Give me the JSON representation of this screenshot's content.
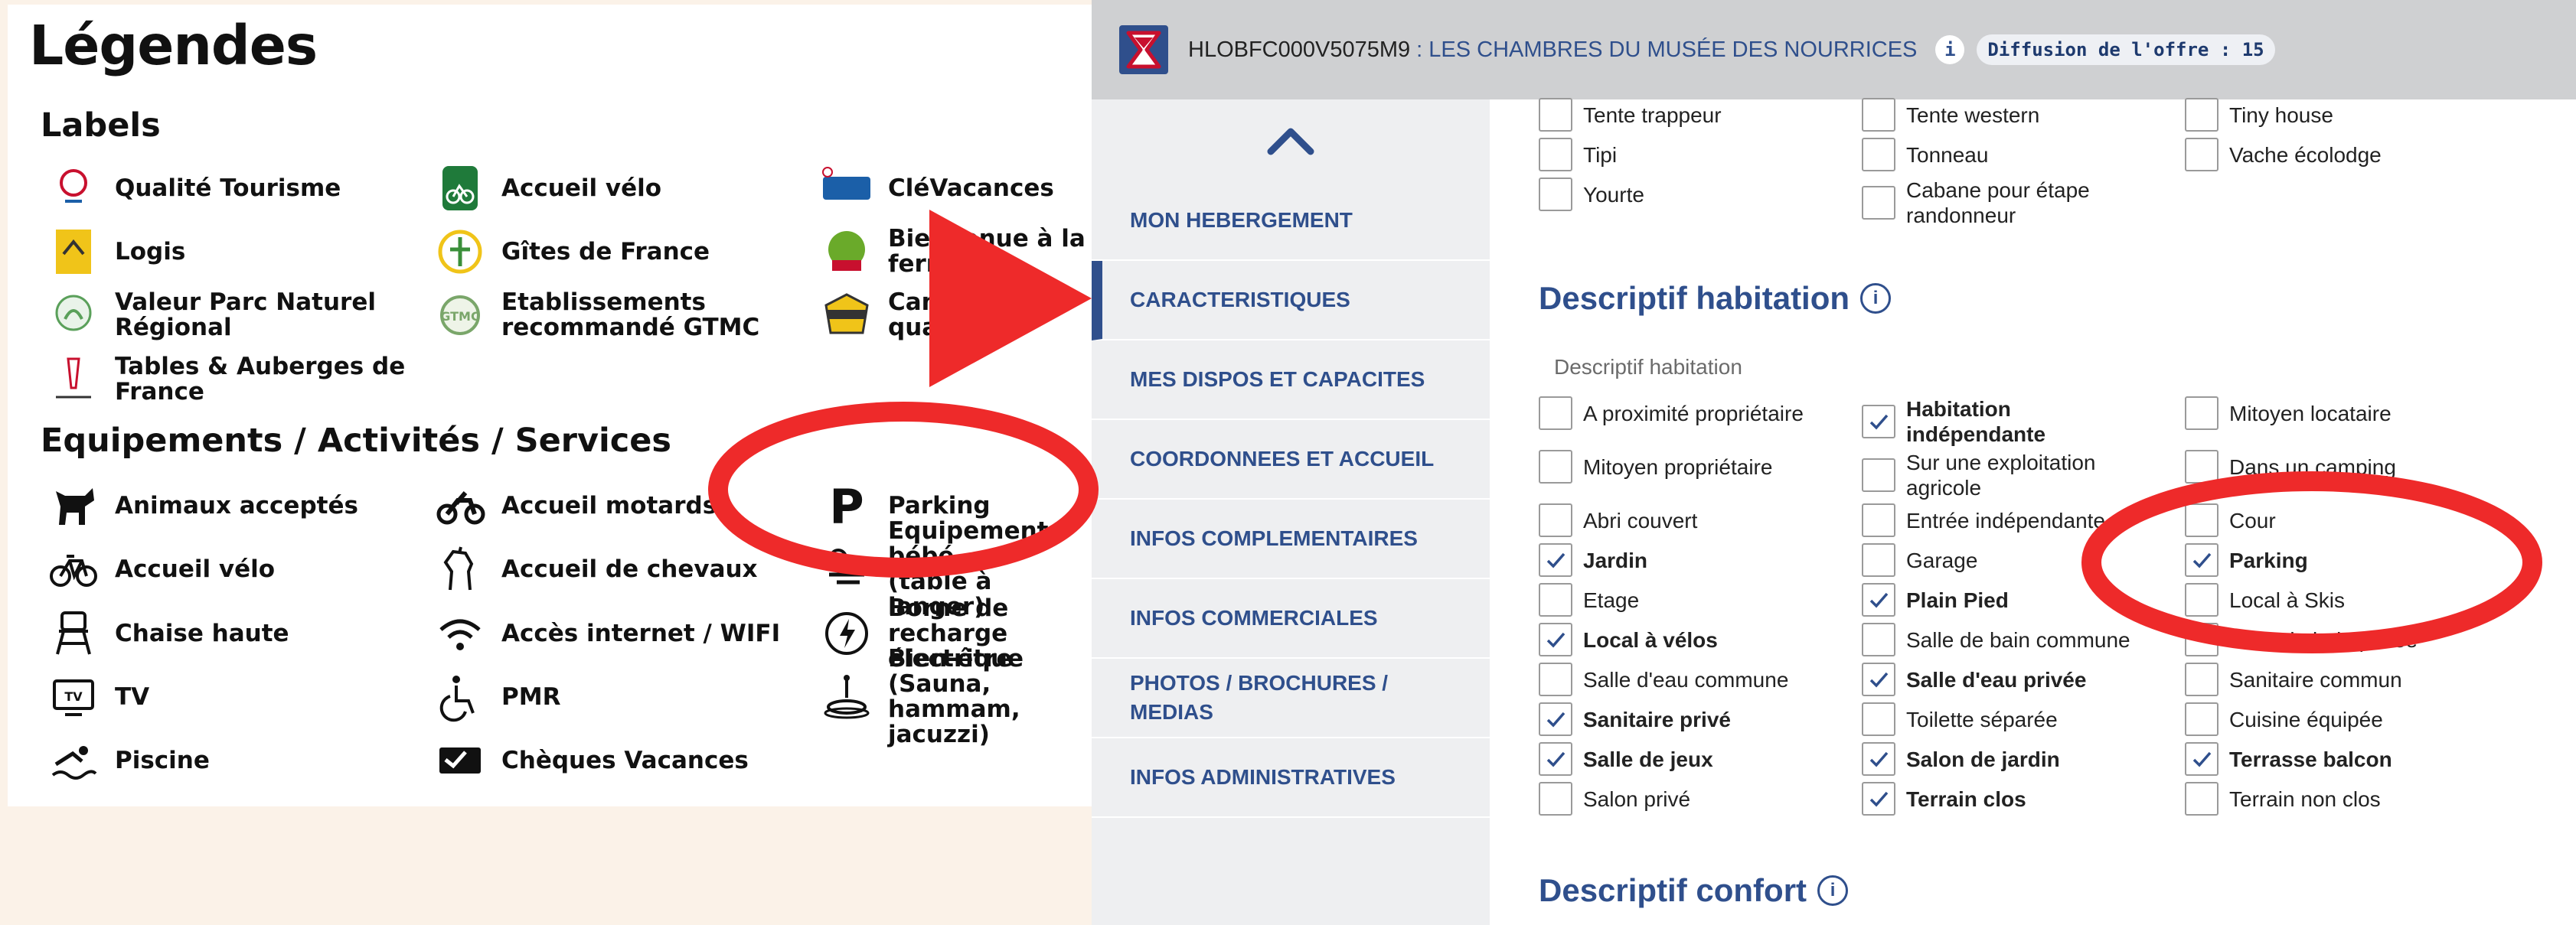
{
  "legend": {
    "title": "Légendes",
    "labels_heading": "Labels",
    "equipments_heading": "Equipements / Activités / Services",
    "labels": [
      {
        "name": "Qualité Tourisme",
        "icon": "qualite-tourisme-logo",
        "color": "#c8102e"
      },
      {
        "name": "Accueil vélo",
        "icon": "accueil-velo-logo",
        "color": "#1f7a3a"
      },
      {
        "name": "CléVacances",
        "icon": "clevacances-logo",
        "color": "#1b5fa8"
      },
      {
        "name": "Logis",
        "icon": "logis-logo",
        "color": "#f0c419"
      },
      {
        "name": "Gîtes de France",
        "icon": "gites-de-france-logo",
        "color": "#3a8f3a"
      },
      {
        "name": "Bienvenue à la ferme",
        "icon": "bienvenue-ferme-logo",
        "color": "#6aaa2a"
      },
      {
        "name": "Valeur Parc Naturel\nRégional",
        "icon": "parc-naturel-logo",
        "color": "#5aa05a"
      },
      {
        "name": "Etablissements\nrecommandé GTMC",
        "icon": "gtmc-logo",
        "color": "#7aa66a"
      },
      {
        "name": "Camping qualité",
        "icon": "camping-qualite-logo",
        "color": "#333333"
      },
      {
        "name": "Tables & Auberges de\nFrance",
        "icon": "tables-auberges-logo",
        "color": "#c8102e"
      }
    ],
    "equipments": [
      {
        "name": "Animaux acceptés",
        "icon": "pet-icon"
      },
      {
        "name": "Accueil motards",
        "icon": "motorcycle-icon"
      },
      {
        "name": "Parking",
        "icon": "parking-icon",
        "glyph": "P"
      },
      {
        "name": "Accueil vélo",
        "icon": "bicycle-icon"
      },
      {
        "name": "Accueil de chevaux",
        "icon": "horse-icon"
      },
      {
        "name": "Equipements bébé\n(table à langer)",
        "icon": "baby-icon"
      },
      {
        "name": "Chaise haute",
        "icon": "high-chair-icon"
      },
      {
        "name": "Accès internet / WIFI",
        "icon": "wifi-icon"
      },
      {
        "name": "Borne de recharge\nélectrique",
        "icon": "ev-charger-icon"
      },
      {
        "name": "TV",
        "icon": "tv-icon"
      },
      {
        "name": "PMR",
        "icon": "wheelchair-icon",
        "glyph": "♿"
      },
      {
        "name": "Bien-être (Sauna,\nhammam, jacuzzi)",
        "icon": "spa-icon"
      },
      {
        "name": "Piscine",
        "icon": "swimming-icon"
      },
      {
        "name": "Chèques Vacances",
        "icon": "cheques-vacances-icon"
      }
    ]
  },
  "app": {
    "header": {
      "id": "HLOBFC000V5075M9",
      "name": ": LES CHAMBRES DU MUSÉE DES NOURRICES",
      "info_badge": "i",
      "diffusion": "Diffusion de l'offre : 15"
    },
    "sidebar": {
      "items": [
        {
          "label": "MON HEBERGEMENT",
          "active": false
        },
        {
          "label": "CARACTERISTIQUES",
          "active": true
        },
        {
          "label": "MES DISPOS ET CAPACITES",
          "active": false
        },
        {
          "label": "COORDONNEES ET ACCUEIL",
          "active": false
        },
        {
          "label": "INFOS COMPLEMENTAIRES",
          "active": false
        },
        {
          "label": "INFOS COMMERCIALES",
          "active": false
        },
        {
          "label": "PHOTOS / BROCHURES /\nMEDIAS",
          "active": false
        },
        {
          "label": "INFOS ADMINISTRATIVES",
          "active": false
        }
      ]
    },
    "top_options": [
      {
        "label": "Tente trappeur",
        "checked": false
      },
      {
        "label": "Tente western",
        "checked": false
      },
      {
        "label": "Tiny house",
        "checked": false
      },
      {
        "label": "Tipi",
        "checked": false
      },
      {
        "label": "Tonneau",
        "checked": false
      },
      {
        "label": "Vache écolodge",
        "checked": false
      },
      {
        "label": "Yourte",
        "checked": false
      },
      {
        "label": "Cabane pour étape\nrandonneur",
        "checked": false
      }
    ],
    "section_habitation": {
      "title": "Descriptif habitation",
      "info": "i",
      "subtitle": "Descriptif habitation",
      "options": [
        {
          "label": "A proximité propriétaire",
          "checked": false
        },
        {
          "label": "Habitation\nindépendante",
          "checked": true
        },
        {
          "label": "Mitoyen locataire",
          "checked": false
        },
        {
          "label": "Mitoyen propriétaire",
          "checked": false
        },
        {
          "label": "Sur une exploitation\nagricole",
          "checked": false
        },
        {
          "label": "Dans un camping",
          "checked": false
        },
        {
          "label": "Abri couvert",
          "checked": false
        },
        {
          "label": "Entrée indépendante",
          "checked": false
        },
        {
          "label": "Cour",
          "checked": false
        },
        {
          "label": "Jardin",
          "checked": true
        },
        {
          "label": "Garage",
          "checked": false
        },
        {
          "label": "Parking",
          "checked": true
        },
        {
          "label": "Etage",
          "checked": false
        },
        {
          "label": "Plain Pied",
          "checked": true
        },
        {
          "label": "Local à Skis",
          "checked": false
        },
        {
          "label": "Local à vélos",
          "checked": true
        },
        {
          "label": "Salle de bain commune",
          "checked": false
        },
        {
          "label": "Salle de bain privée",
          "checked": false
        },
        {
          "label": "Salle d'eau commune",
          "checked": false
        },
        {
          "label": "Salle d'eau privée",
          "checked": true
        },
        {
          "label": "Sanitaire commun",
          "checked": false
        },
        {
          "label": "Sanitaire privé",
          "checked": true
        },
        {
          "label": "Toilette séparée",
          "checked": false
        },
        {
          "label": "Cuisine équipée",
          "checked": false
        },
        {
          "label": "Salle de jeux",
          "checked": true
        },
        {
          "label": "Salon de jardin",
          "checked": true
        },
        {
          "label": "Terrasse balcon",
          "checked": true
        },
        {
          "label": "Salon privé",
          "checked": false
        },
        {
          "label": "Terrain clos",
          "checked": true
        },
        {
          "label": "Terrain non clos",
          "checked": false
        }
      ]
    },
    "section_confort": {
      "title": "Descriptif confort",
      "info": "i"
    }
  },
  "colors": {
    "accent": "#2f4f8c",
    "highlight": "#ee2a2a",
    "page_bg": "#fbf2e8"
  }
}
